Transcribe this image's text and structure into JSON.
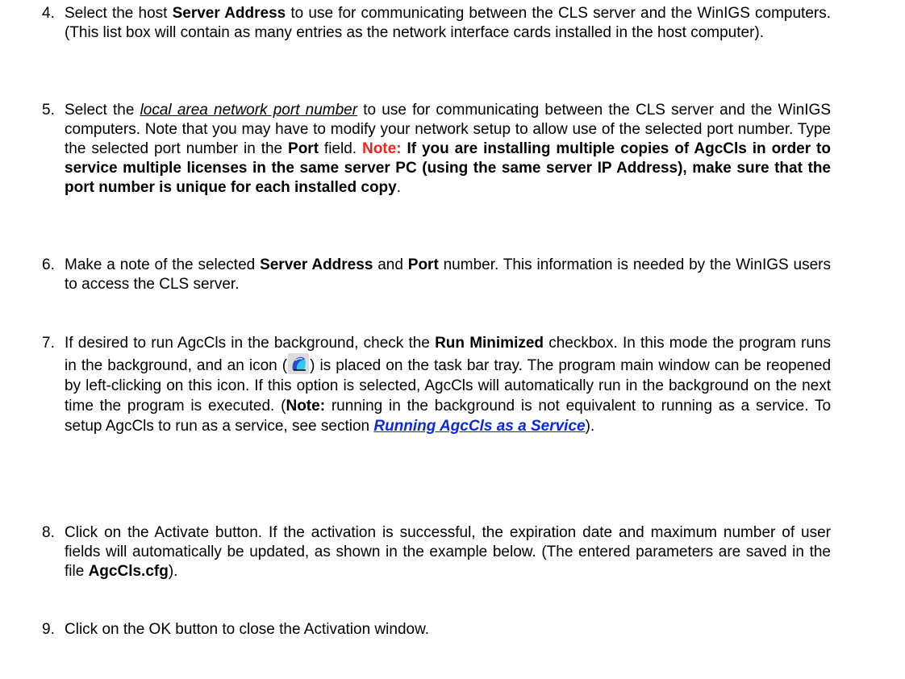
{
  "steps": [
    {
      "num": "4.",
      "p1": "Select the host ",
      "b1": "Server Address",
      "p2": " to use for communicating between the CLS server and the WinIGS computers.  (This list box will contain as many entries as the network interface cards installed in the host computer)."
    },
    {
      "num": "5.",
      "p1": "Select the ",
      "u1": "local area network port number",
      "p2": " to use for communicating between the CLS server and the WinIGS computers.  Note that you may have to modify your network setup to allow use of the selected port number.  Type the selected port number in the ",
      "b1": "Port",
      "p3": " field. ",
      "note_label": "Note:",
      "note_text": "  If you are installing multiple copies of AgcCls in order to service multiple licenses in the same server PC (using the same server IP Address), make sure that the port number is unique for each installed copy",
      "p4": "."
    },
    {
      "num": "6.",
      "p1": "Make a note of the selected ",
      "b1": "Server Address",
      "p2": " and ",
      "b2": "Port",
      "p3": " number.  This information is needed by the WinIGS users to access the CLS server."
    },
    {
      "num": "7.",
      "p1": "If desired to run AgcCls in the background, check the ",
      "b1": "Run Minimized",
      "p2": " checkbox.  In this mode the program runs in the background, and an icon (",
      "icon": "agccls-tray-icon",
      "p3": ") is placed on the task bar tray.  The program main window can be reopened by left-clicking on this icon. If this option is selected, AgcCls will automatically run in the background on the next time the program is executed. (",
      "note_label": "Note:",
      "p4": " running in the background is not equivalent to running as a service.  To setup AgcCls to run as a service, see section ",
      "link": "Running AgcCls as a Service",
      "p5": ")."
    },
    {
      "num": "8.",
      "p1": "Click on the Activate button. If the activation is successful, the expiration date and maximum number of user fields will automatically be updated, as shown in the example below. (The entered parameters are saved in the file ",
      "b1": "AgcCls.cfg",
      "p2": ")."
    },
    {
      "num": "9.",
      "p1": "Click on the OK button to close the Activation window."
    }
  ]
}
